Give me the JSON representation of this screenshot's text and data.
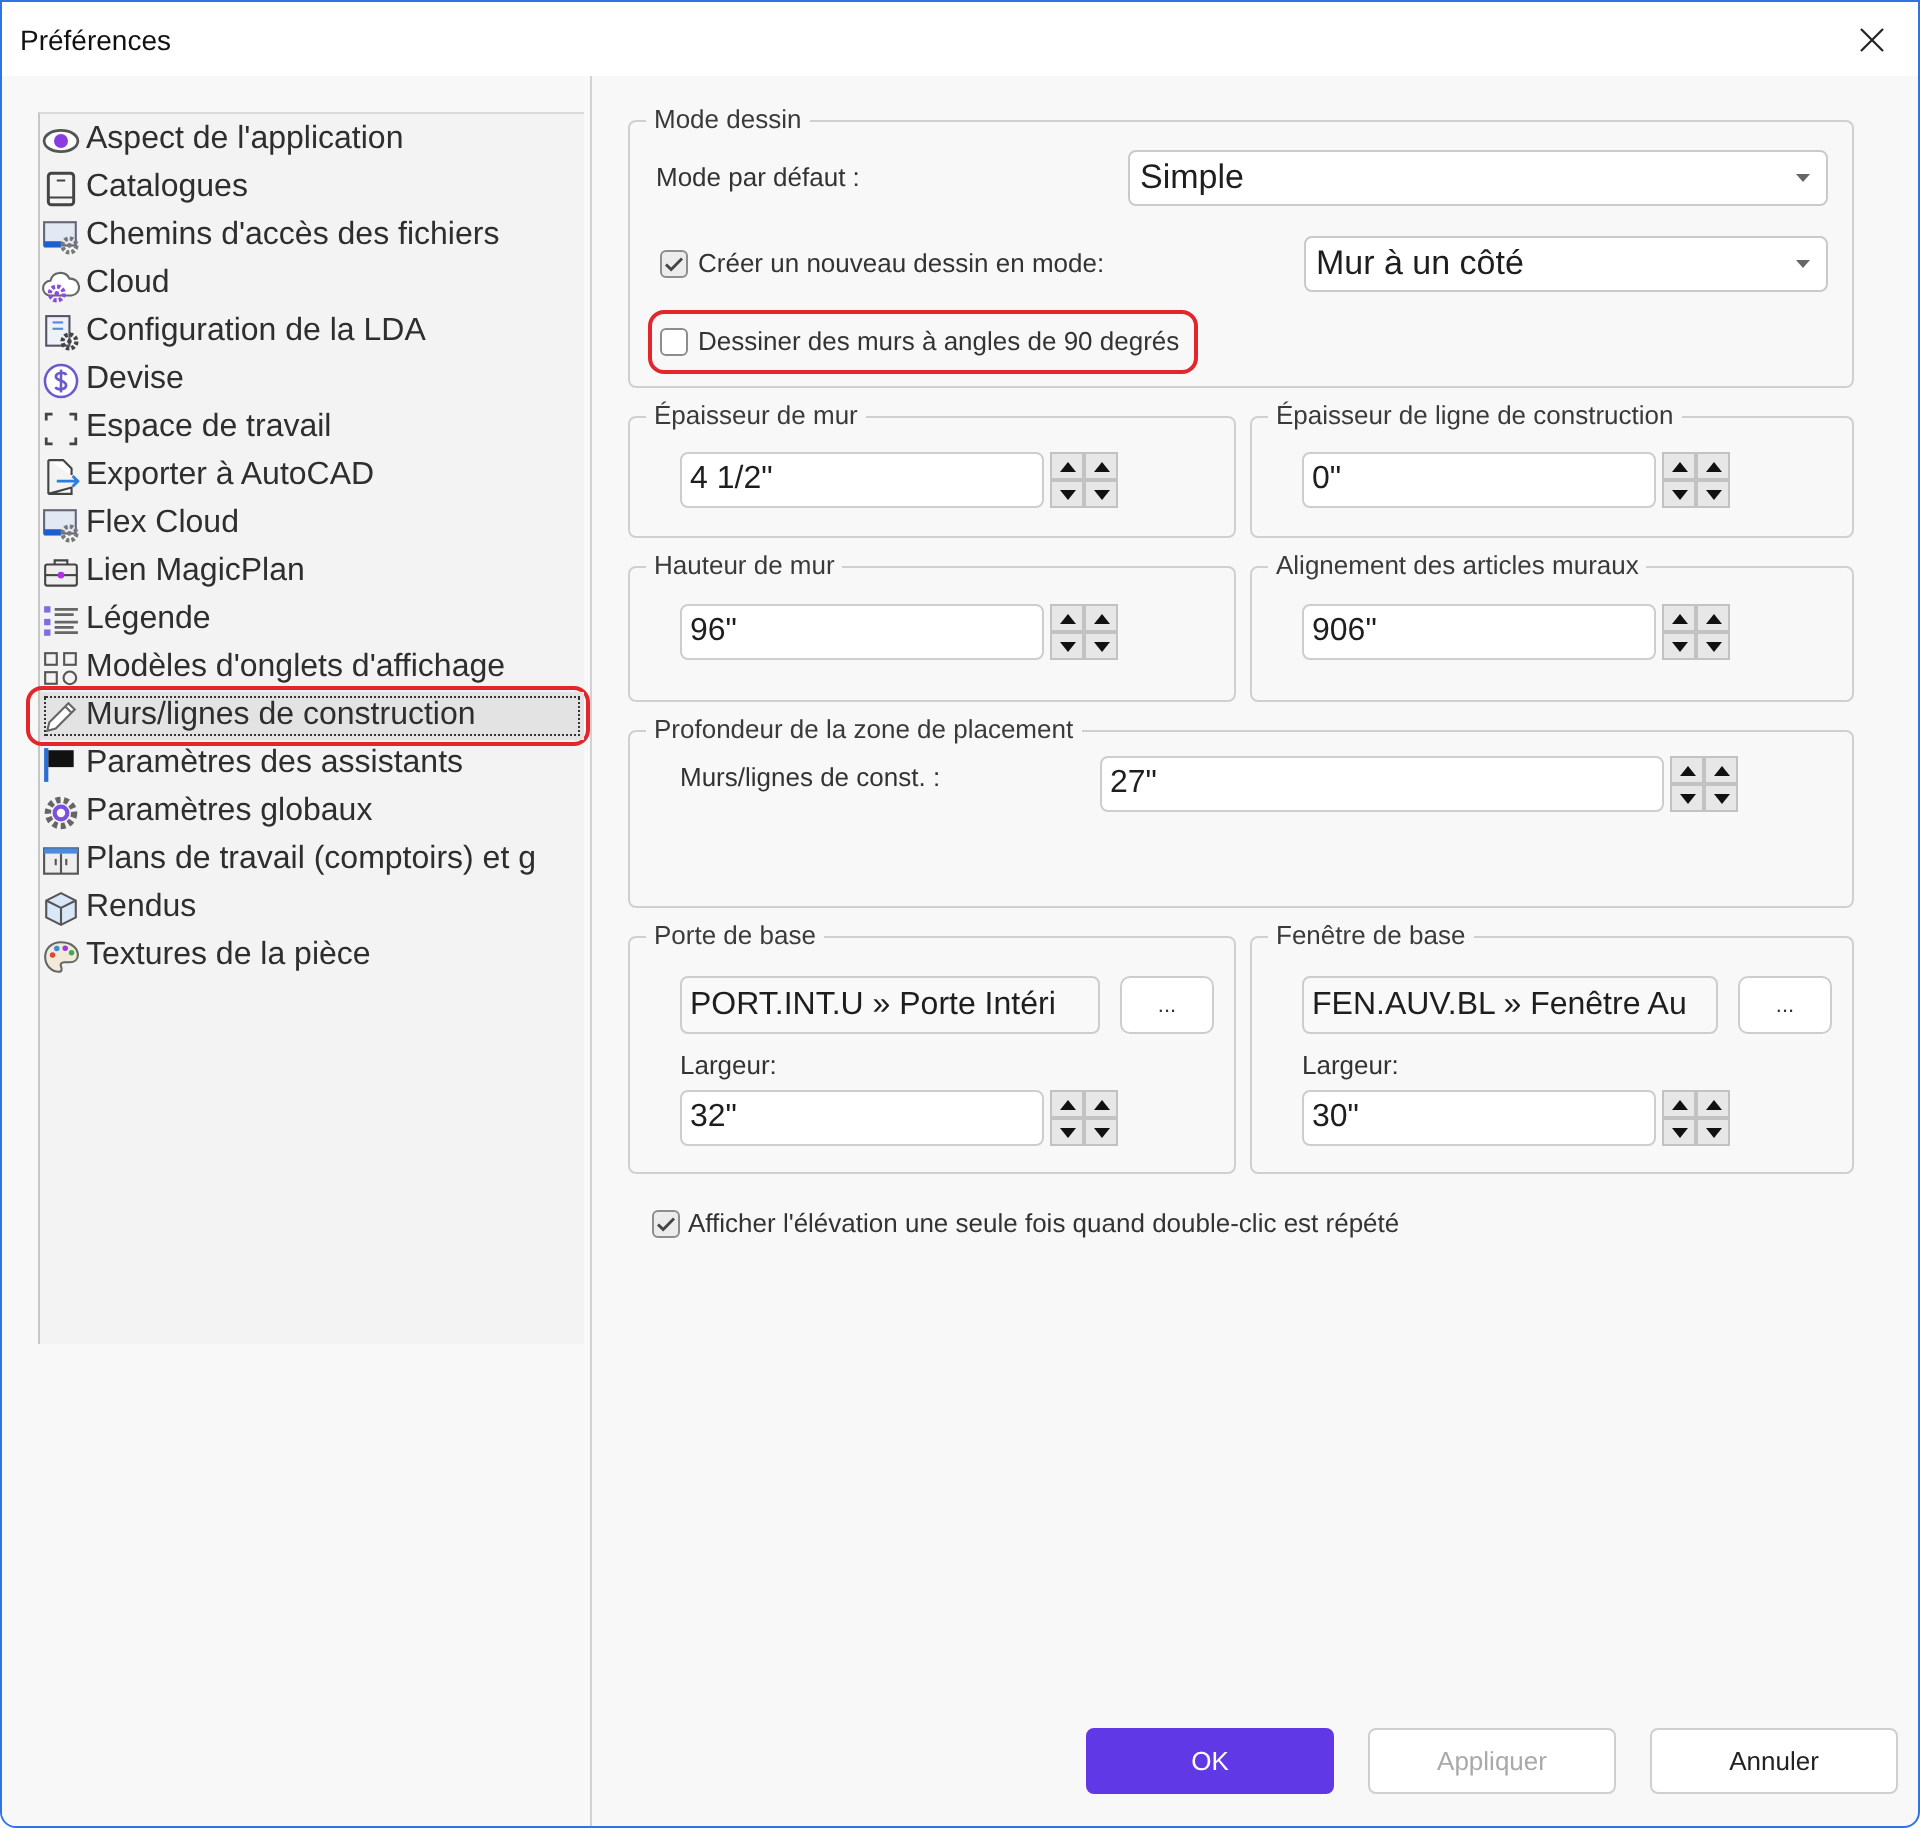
{
  "window": {
    "title": "Préférences"
  },
  "sidebar": {
    "items": [
      {
        "label": "Aspect de l'application",
        "selected": false,
        "highlighted": false
      },
      {
        "label": "Catalogues",
        "selected": false,
        "highlighted": false
      },
      {
        "label": "Chemins d'accès des fichiers",
        "selected": false,
        "highlighted": false
      },
      {
        "label": "Cloud",
        "selected": false,
        "highlighted": false
      },
      {
        "label": "Configuration de la LDA",
        "selected": false,
        "highlighted": false
      },
      {
        "label": "Devise",
        "selected": false,
        "highlighted": false
      },
      {
        "label": "Espace de travail",
        "selected": false,
        "highlighted": false
      },
      {
        "label": "Exporter à AutoCAD",
        "selected": false,
        "highlighted": false
      },
      {
        "label": "Flex Cloud",
        "selected": false,
        "highlighted": false
      },
      {
        "label": "Lien MagicPlan",
        "selected": false,
        "highlighted": false
      },
      {
        "label": "Légende",
        "selected": false,
        "highlighted": false
      },
      {
        "label": "Modèles d'onglets d'affichage",
        "selected": false,
        "highlighted": false
      },
      {
        "label": "Murs/lignes de construction",
        "selected": true,
        "highlighted": true
      },
      {
        "label": "Paramètres des assistants",
        "selected": false,
        "highlighted": false
      },
      {
        "label": "Paramètres globaux",
        "selected": false,
        "highlighted": false
      },
      {
        "label": "Plans de travail (comptoirs) et g",
        "selected": false,
        "highlighted": false
      },
      {
        "label": "Rendus",
        "selected": false,
        "highlighted": false
      },
      {
        "label": "Textures de la pièce",
        "selected": false,
        "highlighted": false
      }
    ]
  },
  "mode_dessin": {
    "title": "Mode dessin",
    "default_mode": {
      "label": "Mode par défaut :",
      "value": "Simple"
    },
    "create_new": {
      "label": "Créer un nouveau dessin en mode:",
      "checked": true,
      "value": "Mur à un côté"
    },
    "right_angles": {
      "label": "Dessiner des murs à angles de 90 degrés",
      "checked": false,
      "highlighted": true
    }
  },
  "measure_groups": [
    {
      "title": "Épaisseur de mur",
      "value": "4 1/2\""
    },
    {
      "title": "Épaisseur de ligne de construction",
      "value": "0\""
    },
    {
      "title": "Hauteur de mur",
      "value": "96\""
    },
    {
      "title": "Alignement des articles muraux",
      "value": "906\""
    }
  ],
  "placement_depth": {
    "title": "Profondeur de la zone de placement",
    "label": "Murs/lignes de const. :",
    "value": "27\""
  },
  "base_items": [
    {
      "title": "Porte de base",
      "item": "PORT.INT.U » Porte Intéri",
      "browse": "...",
      "width_label": "Largeur:",
      "width": "32\""
    },
    {
      "title": "Fenêtre de base",
      "item": "FEN.AUV.BL » Fenêtre Au",
      "browse": "...",
      "width_label": "Largeur:",
      "width": "30\""
    }
  ],
  "elevation_option": {
    "label": "Afficher l'élévation une seule fois quand double-clic est répété",
    "checked": true
  },
  "buttons": [
    {
      "label": "OK",
      "kind": "primary",
      "disabled": false
    },
    {
      "label": "Appliquer",
      "kind": "secondary",
      "disabled": true
    },
    {
      "label": "Annuler",
      "kind": "secondary",
      "disabled": false
    }
  ]
}
